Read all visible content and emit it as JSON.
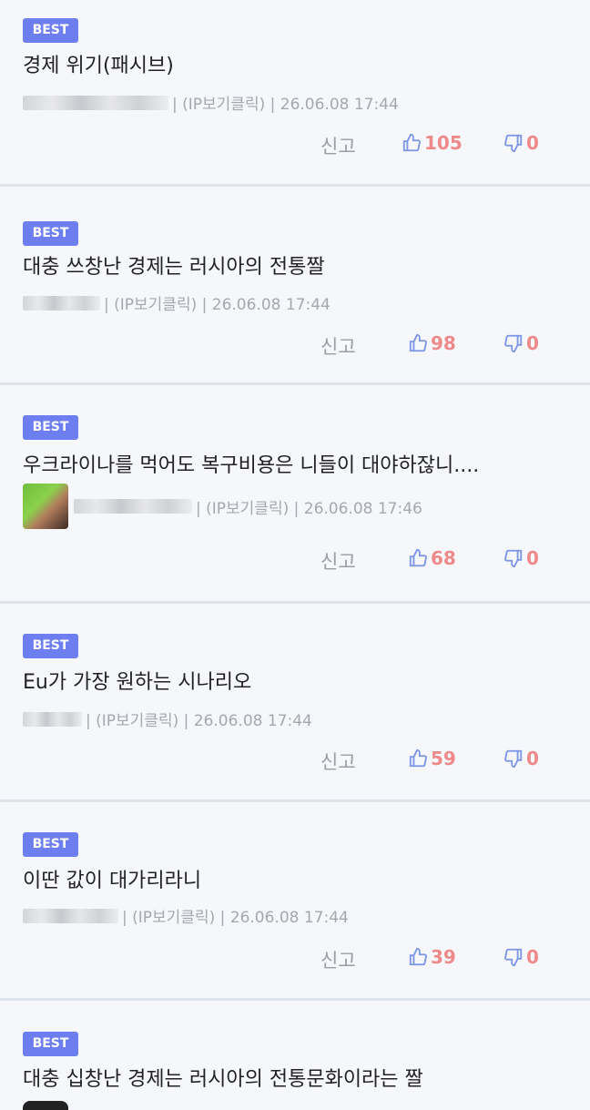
{
  "report_label": "신고",
  "comments": [
    {
      "badge": "BEST",
      "title": "경제 위기(패시브)",
      "meta": "| (IP보기클릭) | 26.06.08 17:44",
      "likes": "105",
      "dislikes": "0"
    },
    {
      "badge": "BEST",
      "title": "대충 쓰창난 경제는 러시아의 전통짤",
      "meta": "| (IP보기클릭) | 26.06.08 17:44",
      "likes": "98",
      "dislikes": "0"
    },
    {
      "badge": "BEST",
      "title": "우크라이나를 먹어도 복구비용은 니들이 대야하잖니....",
      "meta": "| (IP보기클릭) | 26.06.08 17:46",
      "likes": "68",
      "dislikes": "0"
    },
    {
      "badge": "BEST",
      "title": "Eu가 가장 원하는 시나리오",
      "meta": "| (IP보기클릭) | 26.06.08 17:44",
      "likes": "59",
      "dislikes": "0"
    },
    {
      "badge": "BEST",
      "title": "이딴 값이 대가리라니",
      "meta": "| (IP보기클릭) | 26.06.08 17:44",
      "likes": "39",
      "dislikes": "0"
    },
    {
      "badge": "BEST",
      "title": "대충 십창난 경제는 러시아의 전통문화이라는 짤"
    }
  ],
  "colors": {
    "badge": "#6c7ef0",
    "count": "#ef8a8a",
    "thumb": "#7c95e6",
    "meta": "#a5a8ae"
  },
  "icons": {
    "like": "thumbs-up-icon",
    "dislike": "thumbs-down-icon"
  }
}
